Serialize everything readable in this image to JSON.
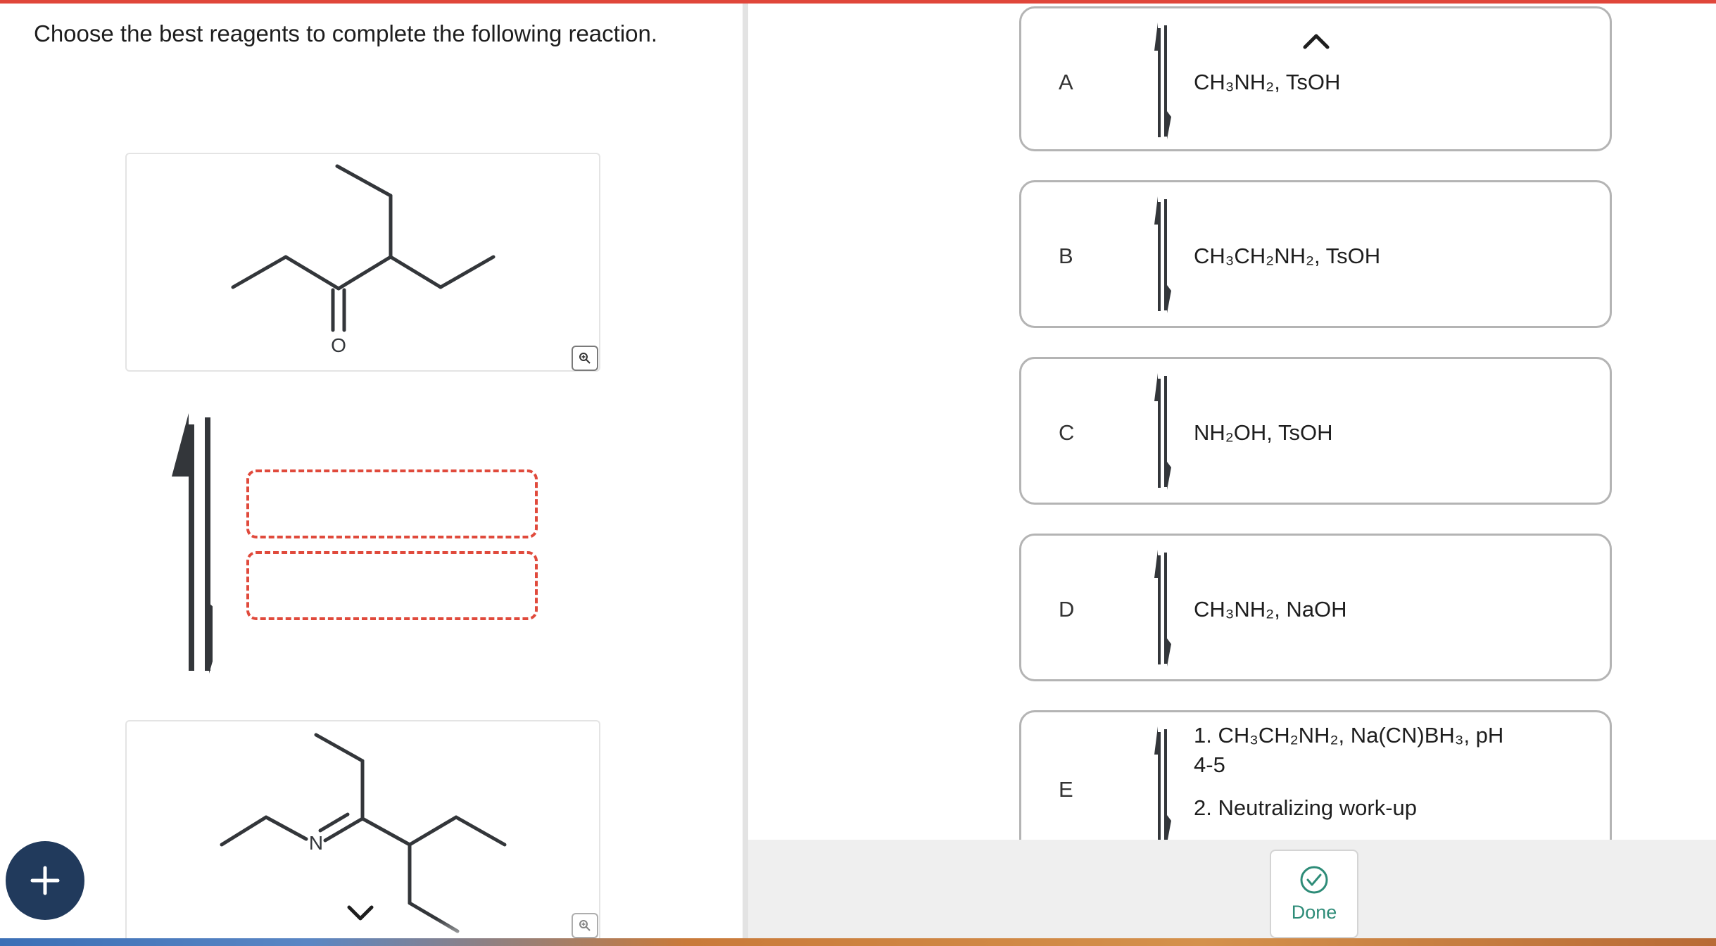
{
  "question": {
    "prompt": "Choose the best reagents to complete the following reaction."
  },
  "molecules": {
    "start": {
      "name": "ketone-starting-material",
      "atom_label": "O"
    },
    "product": {
      "name": "imine-product",
      "atom_label": "N"
    }
  },
  "options": [
    {
      "letter": "A",
      "lines": [
        "CH₃NH₂, TsOH"
      ]
    },
    {
      "letter": "B",
      "lines": [
        "CH₃CH₂NH₂, TsOH"
      ]
    },
    {
      "letter": "C",
      "lines": [
        "NH₂OH, TsOH"
      ]
    },
    {
      "letter": "D",
      "lines": [
        "CH₃NH₂, NaOH"
      ]
    },
    {
      "letter": "E",
      "lines": [
        "1. CH₃CH₂NH₂, Na(CN)BH₃, pH",
        "4-5",
        "2. Neutralizing work-up"
      ]
    }
  ],
  "footer": {
    "done_label": "Done"
  },
  "icons": {
    "zoom": "zoom-in-icon",
    "add": "plus-icon",
    "done": "check-circle-icon",
    "scroll_up": "chevron-up-icon",
    "scroll_down": "chevron-down-icon",
    "reaction_arrow": "equilibrium-arrow-icon"
  },
  "colors": {
    "accent_red": "#e04a3c",
    "add_button": "#213a5c",
    "done_green": "#2e8c78",
    "bond": "#33363a"
  }
}
